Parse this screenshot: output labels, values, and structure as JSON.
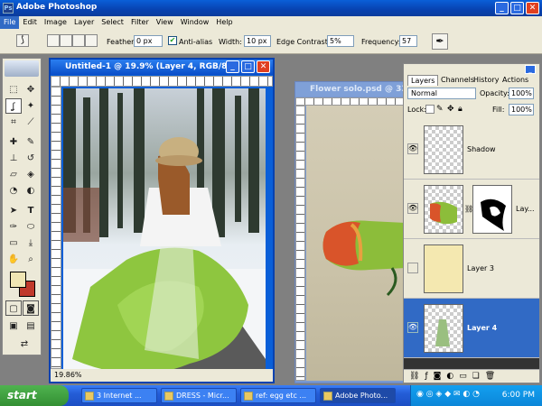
{
  "app": {
    "title": "Adobe Photoshop"
  },
  "menu": [
    "File",
    "Edit",
    "Image",
    "Layer",
    "Select",
    "Filter",
    "View",
    "Window",
    "Help"
  ],
  "options": {
    "feather_label": "Feather:",
    "feather_value": "0 px",
    "antialias_label": "Anti-alias",
    "width_label": "Width:",
    "width_value": "10 px",
    "edge_label": "Edge Contrast:",
    "edge_value": "5%",
    "frequency_label": "Frequency:",
    "frequency_value": "57"
  },
  "doc1": {
    "title": "Untitled-1 @ 19.9% (Layer 4, RGB/8)",
    "zoom": "19.86%"
  },
  "doc2": {
    "title": "Flower solo.psd @ 33..."
  },
  "layers_panel": {
    "tabs": [
      "Layers",
      "Channels",
      "History",
      "Actions"
    ],
    "blend_mode": "Normal",
    "opacity_label": "Opacity:",
    "opacity_value": "100%",
    "lock_label": "Lock:",
    "fill_label": "Fill:",
    "fill_value": "100%",
    "layers": [
      {
        "name": "Shadow",
        "visible": true,
        "selected": false
      },
      {
        "name": "Lay...",
        "visible": true,
        "selected": false
      },
      {
        "name": "Layer 3",
        "visible": false,
        "selected": false
      },
      {
        "name": "Layer 4",
        "visible": true,
        "selected": true
      }
    ]
  },
  "taskbar": {
    "start": "start",
    "tasks": [
      "3 Internet ...",
      "DRESS - Micr...",
      "ref: egg etc ...",
      "Adobe Photo..."
    ],
    "clock": "6:00 PM"
  },
  "colors": {
    "accent": "#316ac5",
    "fg_swatch": "#f0e6b4",
    "bg_swatch": "#c0392b"
  }
}
